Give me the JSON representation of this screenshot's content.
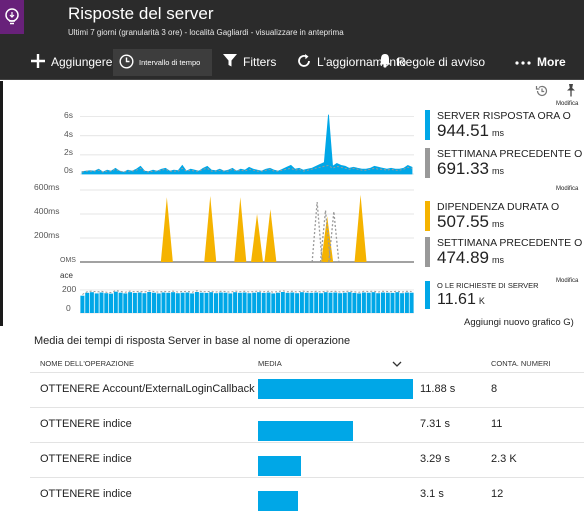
{
  "header": {
    "title": "Risposte del server",
    "subtitle": "Ultimi 7 giorni (granularità 3 ore) - località Gagliardi - visualizzare in anteprima"
  },
  "toolbar": {
    "add_label": "Aggiungere grafico",
    "range_label": "Intervallo di tempo",
    "filters_label": "Fitters",
    "refresh_label": "L'aggiornamento",
    "alerts_label": "Regole di avviso",
    "more_label": "More"
  },
  "edit_label": "Modifica",
  "charts": {
    "response": {
      "y_ticks": [
        "6s",
        "4s",
        "2s",
        "0s"
      ],
      "metric1_label": "SERVER RISPOSTA ORA O",
      "metric1_value": "944.51",
      "metric1_unit": "ms",
      "metric2_label": "SETTIMANA PRECEDENTE O",
      "metric2_value": "691.33",
      "metric2_unit": "ms"
    },
    "dependency": {
      "y_ticks": [
        "600ms",
        "400ms",
        "200ms",
        "OMS"
      ],
      "metric1_label": "DIPENDENZA DURATA O",
      "metric1_value": "507.55",
      "metric1_unit": "ms",
      "metric2_label": "SETTIMANA PRECEDENTE O",
      "metric2_value": "474.89",
      "metric2_unit": "ms"
    },
    "requests": {
      "y_title": "ace",
      "y_ticks": [
        "200",
        "0"
      ],
      "metric1_label": "O LE RICHIESTE DI SERVER",
      "metric1_value": "11.61",
      "metric1_unit": "K"
    },
    "add_chart_label": "Aggiungi nuovo grafico G)"
  },
  "colors": {
    "header_bg": "#2b2b2b",
    "app_icon_bg": "#68217a",
    "accent_blue": "#00a7e7",
    "accent_orange": "#f5b300",
    "comparison_gray": "#999999"
  },
  "chart_data": [
    {
      "type": "area",
      "title": "",
      "ylabel": "",
      "ylim": [
        0,
        7
      ],
      "y_ticks": [
        "0s",
        "2s",
        "4s",
        "6s"
      ],
      "series": [
        {
          "name": "SERVER RISPOSTA ORA O",
          "values": [
            0.25,
            0.3,
            0.35,
            0.3,
            0.5,
            0.2,
            0.4,
            0.3,
            0.6,
            0.3,
            0.2,
            0.4,
            0.3,
            0.5,
            0.8,
            0.3,
            0.25,
            0.4,
            0.3,
            0.5,
            0.6,
            0.3,
            0.4,
            0.35,
            0.9,
            0.3,
            0.5,
            0.4,
            0.3,
            0.6,
            0.8,
            0.4,
            0.35,
            0.5,
            0.3,
            0.4,
            0.6,
            0.3,
            0.5,
            0.4,
            0.7,
            0.5,
            0.4,
            0.3,
            0.5,
            0.6,
            0.4,
            0.3,
            0.5,
            0.7,
            0.9,
            0.5,
            0.6,
            0.4,
            0.5,
            0.6,
            0.8,
            1.0,
            1.2,
            6.2,
            0.8,
            1.1,
            0.9,
            0.8,
            0.6,
            0.7,
            0.6,
            0.5,
            0.5,
            0.6,
            0.8,
            0.7,
            0.6,
            0.5,
            0.6,
            0.5,
            0.5,
            0.6,
            0.9,
            0.7
          ]
        },
        {
          "name": "SETTIMANA PRECEDENTE O",
          "values": [
            0.2,
            0.3,
            0.3,
            0.3,
            0.4,
            0.2,
            0.3,
            0.3,
            0.5,
            0.3,
            0.2,
            0.3,
            0.3,
            0.4,
            0.6,
            0.3,
            0.2,
            0.3,
            0.3,
            0.4,
            0.5,
            0.3,
            0.3,
            0.3,
            0.6,
            0.3,
            0.4,
            0.3,
            0.3,
            0.5,
            0.6,
            0.3,
            0.3,
            0.4,
            0.3,
            0.3,
            0.5,
            0.3,
            0.4,
            0.3,
            0.5,
            0.4,
            0.3,
            0.3,
            0.4,
            0.5,
            0.3,
            0.3,
            0.4,
            0.5,
            0.6,
            0.4,
            0.5,
            0.3,
            0.4,
            0.5,
            0.6,
            0.7,
            0.8,
            0.9,
            0.6,
            0.8,
            0.7,
            0.6,
            0.5,
            0.6,
            0.5,
            0.4,
            0.4,
            0.5,
            0.6,
            0.5,
            0.5,
            0.4,
            0.5,
            0.4,
            0.4,
            0.5,
            0.7,
            0.6
          ]
        }
      ]
    },
    {
      "type": "line",
      "title": "",
      "ylabel": "",
      "ylim": [
        0,
        600
      ],
      "y_ticks": [
        "OMS",
        "200ms",
        "400ms",
        "600ms"
      ],
      "series": [
        {
          "name": "DIPENDENZA DURATA O",
          "values": [
            0,
            0,
            0,
            0,
            0,
            0,
            0,
            0,
            0,
            0,
            0,
            0,
            0,
            0,
            0,
            0,
            0,
            0,
            0,
            0,
            0,
            0,
            0,
            0,
            0,
            0,
            0,
            0,
            0,
            0,
            0,
            0,
            0,
            0,
            0,
            0,
            0,
            0,
            0,
            0,
            0,
            0,
            0,
            0,
            0,
            0,
            0,
            0,
            0,
            0,
            0,
            0,
            0,
            0,
            0,
            0,
            0,
            0,
            0,
            0,
            0,
            0,
            0,
            0,
            0,
            0,
            0,
            0,
            0,
            0,
            0,
            0,
            0,
            0,
            0,
            0,
            0,
            0,
            0,
            0
          ],
          "peaks": [
            {
              "at": 0.26,
              "value": 540
            },
            {
              "at": 0.39,
              "value": 550
            },
            {
              "at": 0.48,
              "value": 540
            },
            {
              "at": 0.53,
              "value": 400
            },
            {
              "at": 0.57,
              "value": 440
            },
            {
              "at": 0.74,
              "value": 380
            },
            {
              "at": 0.84,
              "value": 560
            }
          ]
        },
        {
          "name": "SETTIMANA PRECEDENTE O",
          "peaks": [
            {
              "at": 0.71,
              "value": 500
            },
            {
              "at": 0.735,
              "value": 430
            },
            {
              "at": 0.76,
              "value": 420
            }
          ]
        }
      ]
    },
    {
      "type": "bar",
      "title": "",
      "ylabel": "ace",
      "ylim": [
        0,
        260
      ],
      "y_ticks": [
        "0",
        "200"
      ],
      "series": [
        {
          "name": "O LE RICHIESTE DI SERVER",
          "values": [
            150,
            175,
            180,
            170,
            178,
            172,
            168,
            185,
            176,
            170,
            180,
            174,
            178,
            172,
            182,
            176,
            170,
            178,
            175,
            180,
            172,
            176,
            178,
            170,
            182,
            176,
            174,
            180,
            172,
            178,
            176,
            170,
            180,
            175,
            178,
            172,
            176,
            180,
            174,
            178,
            170,
            176,
            182,
            175,
            178,
            172,
            180,
            176,
            174,
            178,
            172,
            180,
            176,
            178,
            172,
            176,
            180,
            174,
            170,
            178,
            176,
            180,
            172,
            178,
            176,
            174,
            180,
            172,
            178,
            176
          ]
        },
        {
          "name": "SETTIMANA PRECEDENTE O",
          "values": [
            160,
            185,
            190,
            182,
            188,
            180,
            178,
            195,
            186,
            180,
            190,
            184,
            188,
            182,
            192,
            186,
            180,
            188,
            185,
            190,
            182,
            186,
            188,
            180,
            192,
            186,
            184,
            190,
            182,
            188,
            186,
            180,
            190,
            185,
            188,
            182,
            186,
            190,
            184,
            188,
            180,
            186,
            192,
            185,
            188,
            182,
            190,
            186,
            184,
            188,
            182,
            190,
            186,
            188,
            182,
            186,
            190,
            184,
            180,
            188,
            186,
            190,
            182,
            188,
            186,
            184,
            190,
            182,
            188,
            186
          ]
        }
      ]
    },
    {
      "type": "table",
      "title": "Media dei tempi di risposta Server in base al nome di operazione",
      "columns": [
        "NOME DELL'OPERAZIONE",
        "MEDIA",
        "CONTA. NUMERI"
      ],
      "rows": [
        {
          "name": "OTTENERE Account/ExternalLoginCallback",
          "avg": "11.88 s",
          "avg_value": 11.88,
          "count": "8"
        },
        {
          "name": "OTTENERE indice",
          "avg": "7.31 s",
          "avg_value": 7.31,
          "count": "11"
        },
        {
          "name": "OTTENERE indice",
          "avg": "3.29 s",
          "avg_value": 3.29,
          "count": "2.3 K"
        },
        {
          "name": "OTTENERE indice",
          "avg": "3.1 s",
          "avg_value": 3.1,
          "count": "12"
        }
      ]
    }
  ],
  "table": {
    "title": "Media dei tempi di risposta Server in base al nome di operazione",
    "col_name": "NOME DELL'OPERAZIONE",
    "col_avg": "MEDIA",
    "col_count": "CONTA. NUMERI"
  }
}
